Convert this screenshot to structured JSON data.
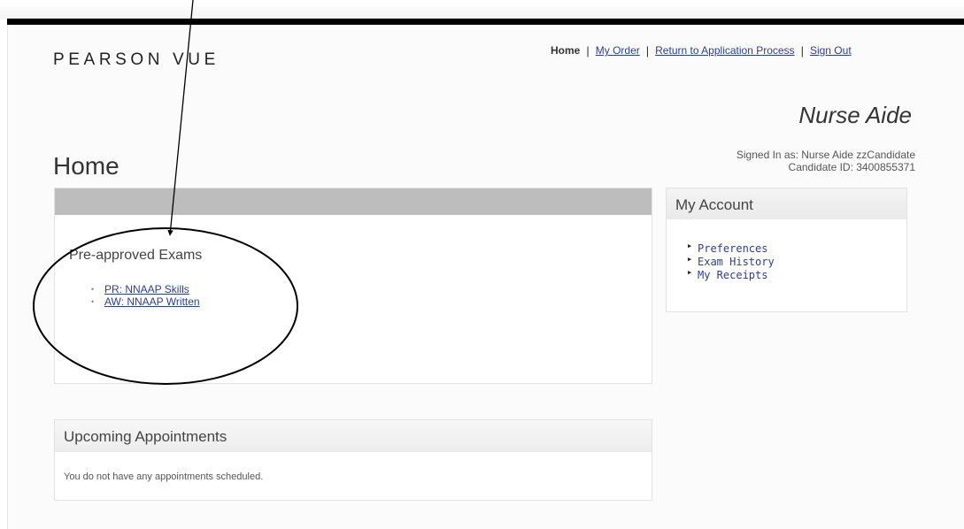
{
  "header": {
    "logo": "PEARSON VUE",
    "nav": {
      "home": "Home",
      "my_order": "My Order",
      "return_to_application": "Return to Application Process",
      "sign_out": "Sign Out",
      "separator": "|"
    },
    "program_title": "Nurse Aide",
    "signed_in_as": "Signed In as: Nurse Aide zzCandidate",
    "candidate_id": "Candidate ID: 3400855371"
  },
  "main": {
    "page_title": "Home",
    "exams_panel": {
      "heading": "Pre-approved Exams",
      "exams": [
        "PR: NNAAP Skills",
        "AW: NNAAP Written"
      ]
    },
    "appointments_panel": {
      "title": "Upcoming Appointments",
      "message": "You do not have any appointments scheduled."
    }
  },
  "sidebar": {
    "title": "My Account",
    "items": [
      "Preferences",
      "Exam History",
      "My Receipts"
    ]
  },
  "colors": {
    "link": "#2c3f8f",
    "panel_bar": "#bdbdbd",
    "top_bar": "#000000"
  }
}
